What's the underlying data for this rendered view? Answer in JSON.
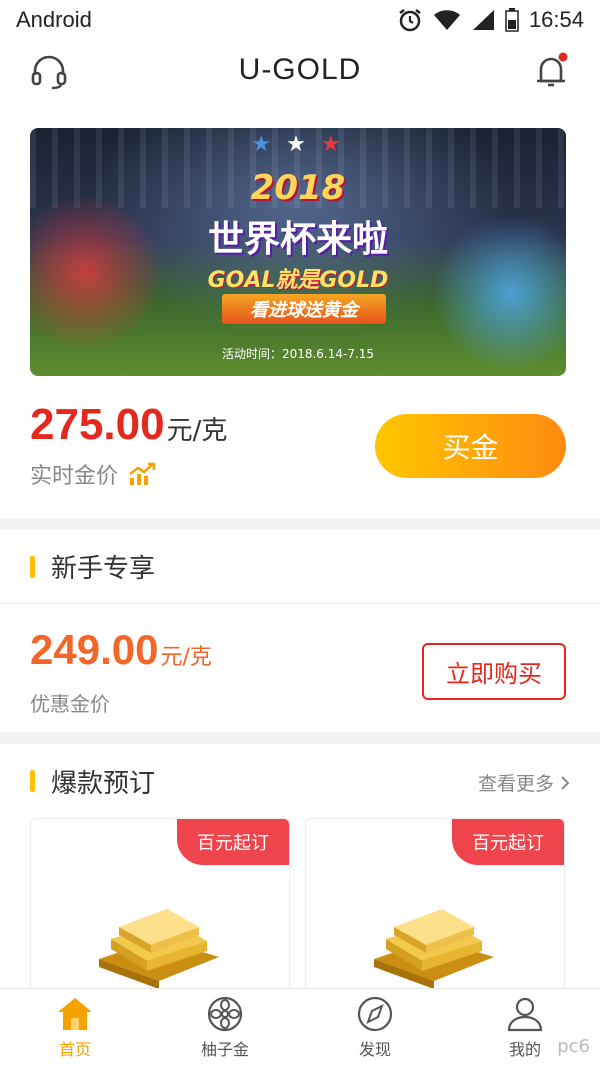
{
  "status_bar": {
    "carrier": "Android",
    "time": "16:54"
  },
  "header": {
    "title": "U-GOLD",
    "support_icon": "headset-icon",
    "bell_icon": "bell-icon",
    "bell_badge_color": "#e5281d"
  },
  "banner": {
    "stars": "★ ★ ★",
    "year": "2018",
    "headline": "世界杯来啦",
    "subline": "GOAL就是GOLD",
    "ribbon": "看进球送黄金",
    "date": "活动时间：2018.6.14-7.15"
  },
  "realtime": {
    "price": "275.00",
    "unit": "元/克",
    "label": "实时金价",
    "trend_icon": "trend-up-icon",
    "buy_label": "买金"
  },
  "newbie": {
    "section_title": "新手专享",
    "price": "249.00",
    "unit": "元/克",
    "label": "优惠金价",
    "buy_label": "立即购买"
  },
  "hot": {
    "section_title": "爆款预订",
    "more_label": "查看更多",
    "products": [
      {
        "tag": "百元起订"
      },
      {
        "tag": "百元起订"
      }
    ]
  },
  "tabs": [
    {
      "label": "首页",
      "icon": "home-icon",
      "active": true
    },
    {
      "label": "柚子金",
      "icon": "grapefruit-icon",
      "active": false
    },
    {
      "label": "发现",
      "icon": "compass-icon",
      "active": false
    },
    {
      "label": "我的",
      "icon": "user-icon",
      "active": false
    }
  ],
  "colors": {
    "accent": "#ffc107",
    "primary_red": "#e5281d",
    "orange": "#f2662a"
  },
  "watermark": "pc6"
}
